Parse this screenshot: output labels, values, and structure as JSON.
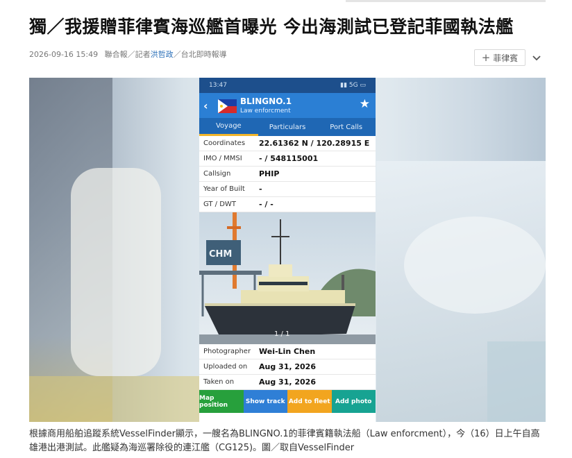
{
  "article": {
    "headline": "獨／我援贈菲律賓海巡艦首曝光 今出海測試已登記菲國執法艦",
    "date": "2026-09-16 15:49",
    "source": "聯合報／記者",
    "reporter": "洪哲政",
    "location": "／台北即時報導",
    "tag_label": "菲律賓",
    "caption": "根據商用船舶追蹤系統VesselFinder顯示，一艘名為BLINGNO.1的菲律賓籍執法船（Law enforcment），今（16）日上午自高雄港出港測試。此艦疑為海巡署除役的連江艦（CG125)。圖／取自VesselFinder"
  },
  "phone": {
    "status_time": "13:47",
    "status_icons": "▮▮ 5G ▭",
    "vessel_name": "BLINGNO.1",
    "vessel_type": "Law enforcment",
    "tabs": [
      "Voyage",
      "Particulars",
      "Port Calls"
    ],
    "active_tab": "Voyage",
    "fields": [
      {
        "label": "Coordinates",
        "value": "22.61362 N / 120.28915 E"
      },
      {
        "label": "IMO / MMSI",
        "value": "- / 548115001"
      },
      {
        "label": "Callsign",
        "value": "PHIP"
      },
      {
        "label": "Year of Built",
        "value": "-"
      },
      {
        "label": "GT / DWT",
        "value": "- / -"
      }
    ],
    "photo_counter": "1 / 1",
    "crane_text": "CHM",
    "photo_fields": [
      {
        "label": "Photographer",
        "value": "Wei-Lin Chen"
      },
      {
        "label": "Uploaded on",
        "value": "Aug 31, 2026"
      },
      {
        "label": "Taken on",
        "value": "Aug 31, 2026"
      }
    ],
    "actions": [
      {
        "label": "Map position",
        "color": "#27a03c"
      },
      {
        "label": "Show track",
        "color": "#2f7fd6"
      },
      {
        "label": "Add to fleet",
        "color": "#f2a51f"
      },
      {
        "label": "Add photo",
        "color": "#17a392"
      }
    ],
    "colors": {
      "header": "#2b7fd4",
      "tabs": "#1f67b4",
      "status": "#1d4f8c",
      "tab_indicator": "#f1b52b"
    }
  }
}
